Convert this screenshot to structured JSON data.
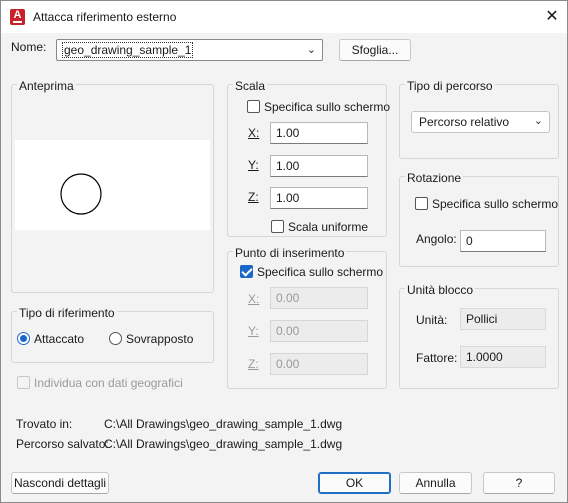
{
  "title": "Attacca riferimento esterno",
  "name_label": "Nome:",
  "name_value": "geo_drawing_sample_1",
  "browse_label": "Sfoglia...",
  "preview": {
    "title": "Anteprima"
  },
  "ref_type": {
    "title": "Tipo di riferimento",
    "attached": "Attaccato",
    "overlay": "Sovrapposto",
    "selected": "Attaccato"
  },
  "geo_checkbox": "Individua con dati geografici",
  "scale": {
    "title": "Scala",
    "specify": "Specifica sullo schermo",
    "specify_checked": false,
    "x_label": "X:",
    "x": "1.00",
    "y_label": "Y:",
    "y": "1.00",
    "z_label": "Z:",
    "z": "1.00",
    "uniform": "Scala uniforme",
    "uniform_checked": false
  },
  "insertion": {
    "title": "Punto di inserimento",
    "specify": "Specifica sullo schermo",
    "specify_checked": true,
    "x_label": "X:",
    "x": "0.00",
    "y_label": "Y:",
    "y": "0.00",
    "z_label": "Z:",
    "z": "0.00"
  },
  "path_type": {
    "title": "Tipo di percorso",
    "value": "Percorso relativo"
  },
  "rotation": {
    "title": "Rotazione",
    "specify": "Specifica sullo schermo",
    "specify_checked": false,
    "angle_label": "Angolo:",
    "angle": "0"
  },
  "block_unit": {
    "title": "Unità blocco",
    "unit_label": "Unità:",
    "unit": "Pollici",
    "factor_label": "Fattore:",
    "factor": "1.0000"
  },
  "found_in_label": "Trovato in:",
  "found_in": "C:\\All Drawings\\geo_drawing_sample_1.dwg",
  "saved_path_label": "Percorso salvato:",
  "saved_path": "C:\\All Drawings\\geo_drawing_sample_1.dwg",
  "buttons": {
    "hide": "Nascondi dettagli",
    "ok": "OK",
    "cancel": "Annulla",
    "help": "?"
  },
  "colors": {
    "accent": "#1a66c9",
    "app_icon": "#c8212b"
  },
  "icons": {
    "app": "autocad-icon",
    "close": "close-icon",
    "dropdown": "chevron-down-icon"
  }
}
